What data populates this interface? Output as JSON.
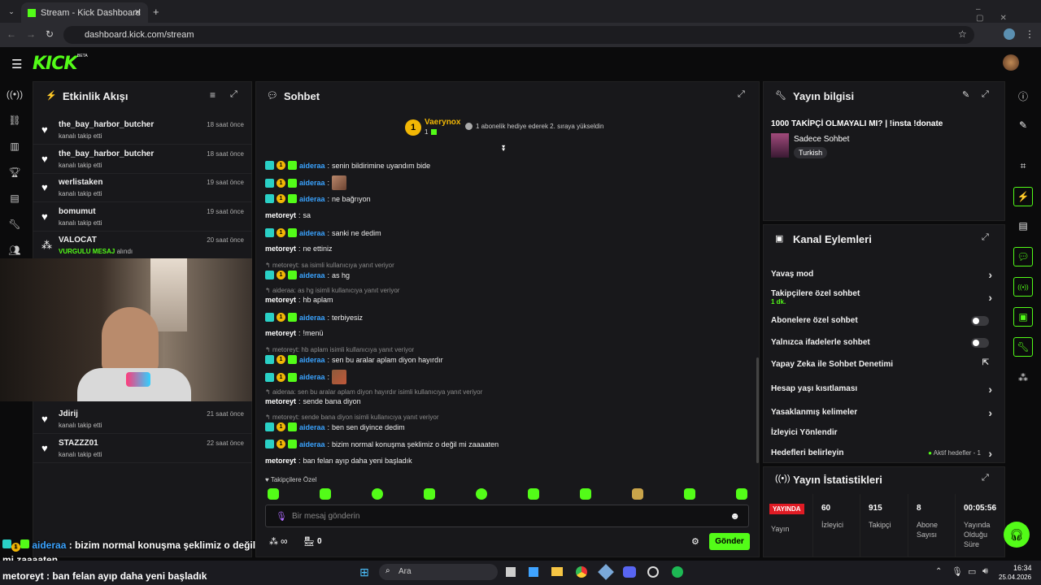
{
  "browser": {
    "tab_title": "Stream - Kick Dashboard",
    "url": "dashboard.kick.com/stream"
  },
  "header": {
    "logo": "KICK",
    "beta": "BETA"
  },
  "activity": {
    "title": "Etkinlik Akışı",
    "items": [
      {
        "name": "the_bay_harbor_butcher",
        "sub": "kanalı takip etti",
        "time": "18 saat önce"
      },
      {
        "name": "the_bay_harbor_butcher",
        "sub": "kanalı takip etti",
        "time": "18 saat önce"
      },
      {
        "name": "werlistaken",
        "sub": "kanalı takip etti",
        "time": "19 saat önce"
      },
      {
        "name": "bomumut",
        "sub": "kanalı takip etti",
        "time": "19 saat önce"
      },
      {
        "name": "VALOCAT",
        "sub_highlight": "VURGULU MESAJ",
        "sub_rest": "alındı",
        "time": "20 saat önce"
      },
      {
        "name": "Jdirij",
        "sub": "kanalı takip etti",
        "time": "21 saat önce"
      },
      {
        "name": "STAZZZ01",
        "sub": "kanalı takip etti",
        "time": "22 saat önce"
      }
    ]
  },
  "chat": {
    "title": "Sohbet",
    "pinned": {
      "user": "Vaerynox",
      "count": "1",
      "badge": "1",
      "text": "1 abonelik hediye ederek 2. sıraya yükseldin"
    },
    "messages": [
      {
        "user": "aideraa",
        "text": "senin bildirimine uyandım bide"
      },
      {
        "user": "aideraa",
        "text": ""
      },
      {
        "user": "aideraa",
        "text": "ne bağrıyon"
      },
      {
        "user": "metoreyt",
        "text": "sa"
      },
      {
        "user": "aideraa",
        "text": "sanki ne dedim"
      },
      {
        "user": "metoreyt",
        "text": "ne ettiniz"
      },
      {
        "reply": "metoreyt: sa isimli kullanıcıya yanıt veriyor"
      },
      {
        "user": "aideraa",
        "text": "as hg"
      },
      {
        "reply": "aideraa: as hg isimli kullanıcıya yanıt veriyor"
      },
      {
        "user": "metoreyt",
        "text": "hb aplam"
      },
      {
        "user": "aideraa",
        "text": "terbiyesiz"
      },
      {
        "user": "metoreyt",
        "text": "!menü"
      },
      {
        "reply": "metoreyt: hb aplam isimli kullanıcıya yanıt veriyor"
      },
      {
        "user": "aideraa",
        "text": "sen bu aralar aplam diyon hayırdır"
      },
      {
        "user": "aideraa",
        "text": ""
      },
      {
        "reply": "aideraa: sen bu aralar aplam diyon hayırdır isimli kullanıcıya yanıt veriyor"
      },
      {
        "user": "metoreyt",
        "text": "sende bana diyon"
      },
      {
        "reply": "metoreyt: sende bana diyon isimli kullanıcıya yanıt veriyor"
      },
      {
        "user": "aideraa",
        "text": "ben sen diyince dedim"
      },
      {
        "user": "aideraa",
        "text": "bizim normal konuşma şeklimiz o değil mi zaaaaten"
      },
      {
        "user": "metoreyt",
        "text": "ban felan ayıp daha yeni başladık"
      }
    ],
    "followers_only": "Takipçilere Özel",
    "input_placeholder": "Bir mesaj gönderin",
    "infinity": "∞",
    "points": "0",
    "send": "Gönder"
  },
  "streaminfo": {
    "title": "Yayın bilgisi",
    "stream_title": "1000 TAKİPÇİ OLMAYALI MI? | !insta !donate",
    "category": "Sadece Sohbet",
    "language": "Turkish"
  },
  "actions": {
    "title": "Kanal Eylemleri",
    "items": [
      {
        "label": "Yavaş mod",
        "type": "chevron"
      },
      {
        "label": "Takipçilere özel sohbet",
        "sub": "1 dk.",
        "type": "chevron"
      },
      {
        "label": "Abonelere özel sohbet",
        "type": "toggle"
      },
      {
        "label": "Yalnızca ifadelerle sohbet",
        "type": "toggle"
      },
      {
        "label": "Yapay Zeka ile Sohbet Denetimi",
        "type": "external"
      },
      {
        "label": "Hesap yaşı kısıtlaması",
        "type": "chevron"
      },
      {
        "label": "Yasaklanmış kelimeler",
        "type": "chevron"
      },
      {
        "label": "İzleyici Yönlendir",
        "type": "none"
      },
      {
        "label": "Hedefleri belirleyin",
        "type": "chevron",
        "status": "Aktif hedefler - 1"
      }
    ]
  },
  "stats": {
    "title": "Yayın İstatistikleri",
    "live": "YAYINDA",
    "items": [
      {
        "value": "",
        "label": "Yayın"
      },
      {
        "value": "60",
        "label": "İzleyici"
      },
      {
        "value": "915",
        "label": "Takipçi"
      },
      {
        "value": "8",
        "label": "Abone Sayısı"
      },
      {
        "value": "00:05:56",
        "label": "Yayında Olduğu Süre"
      }
    ]
  },
  "overlay": {
    "user1": "aideraa",
    "msg1a": " : bizim normal konuşma şeklimiz o değil",
    "msg1b": "mi zaaaaten",
    "user2": "metoreyt",
    "msg2": " : ban felan ayıp daha yeni başladık"
  },
  "taskbar": {
    "search": "Ara",
    "time": "16:34",
    "date": "25.04.2026"
  },
  "colors": {
    "accent": "#53fc18",
    "username": "#3aa3ff",
    "live": "#e01b24"
  }
}
